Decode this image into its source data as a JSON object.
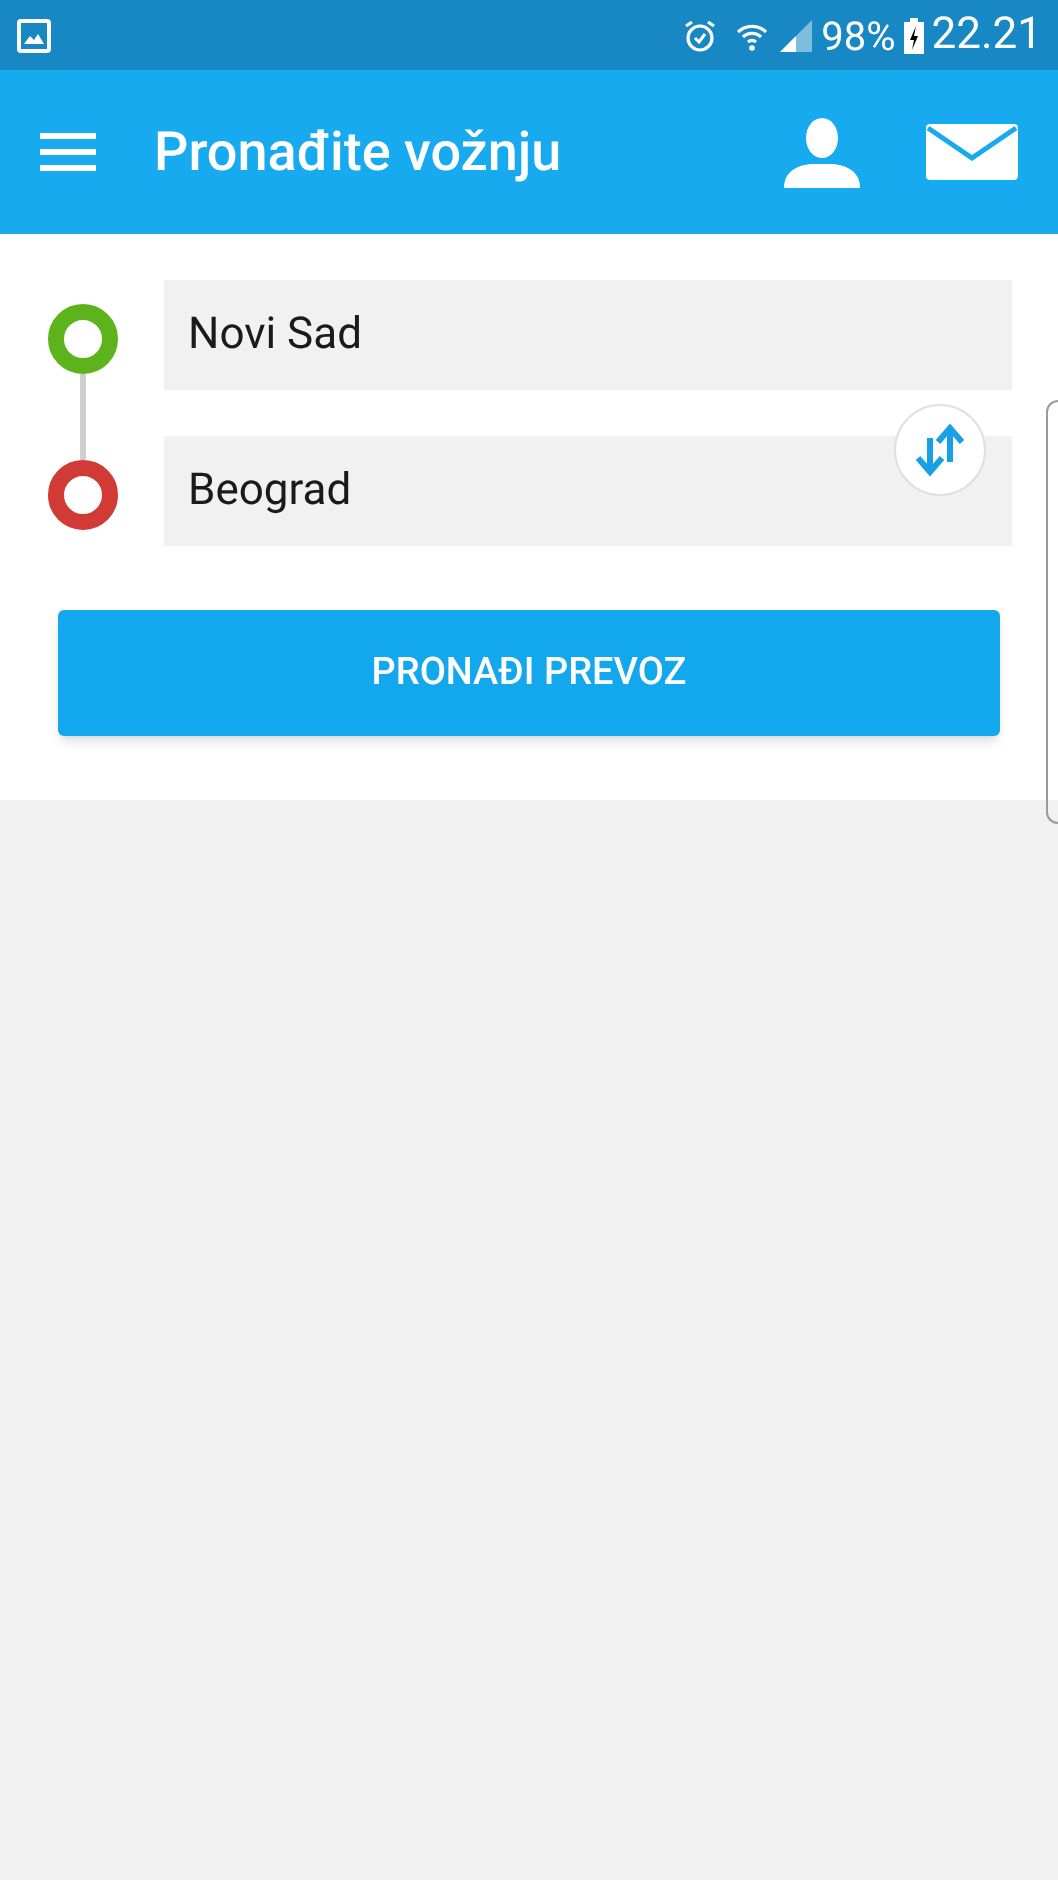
{
  "status_bar": {
    "battery": "98%",
    "time": "22.21"
  },
  "toolbar": {
    "title": "Pronađite vožnju"
  },
  "stops": [
    {
      "value": "Novi Sad",
      "color": "#5cb31c"
    },
    {
      "value": "Beograd",
      "color": "#d23b35"
    }
  ],
  "search_button": "PRONAĐI PREVOZ"
}
